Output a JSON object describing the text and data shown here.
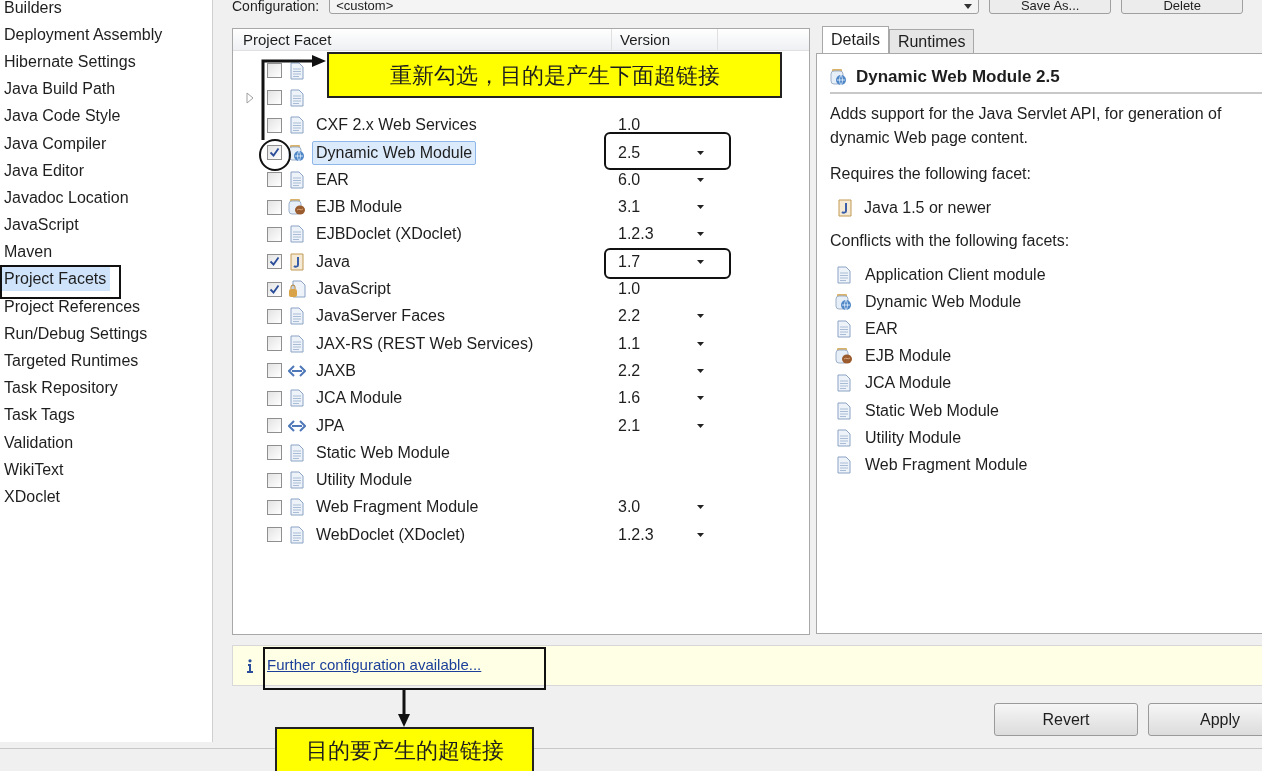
{
  "sidebar": {
    "items": [
      {
        "label": "Builders",
        "selected": false
      },
      {
        "label": "Deployment Assembly",
        "selected": false
      },
      {
        "label": "Hibernate Settings",
        "selected": false
      },
      {
        "label": "Java Build Path",
        "selected": false
      },
      {
        "label": "Java Code Style",
        "selected": false
      },
      {
        "label": "Java Compiler",
        "selected": false
      },
      {
        "label": "Java Editor",
        "selected": false
      },
      {
        "label": "Javadoc Location",
        "selected": false
      },
      {
        "label": "JavaScript",
        "selected": false
      },
      {
        "label": "Maven",
        "selected": false
      },
      {
        "label": "Project Facets",
        "selected": true
      },
      {
        "label": "Project References",
        "selected": false
      },
      {
        "label": "Run/Debug Settings",
        "selected": false
      },
      {
        "label": "Targeted Runtimes",
        "selected": false
      },
      {
        "label": "Task Repository",
        "selected": false
      },
      {
        "label": "Task Tags",
        "selected": false
      },
      {
        "label": "Validation",
        "selected": false
      },
      {
        "label": "WikiText",
        "selected": false
      },
      {
        "label": "XDoclet",
        "selected": false
      }
    ]
  },
  "configuration": {
    "label": "Configuration:",
    "value": "<custom>",
    "buttons": [
      "Save As...",
      "Delete"
    ]
  },
  "table": {
    "columns": [
      "Project Facet",
      "Version"
    ],
    "rows": [
      {
        "kind": "file",
        "checked": false,
        "selected": false,
        "expander": false,
        "dropdown": false
      },
      {
        "kind": "file",
        "checked": false,
        "selected": false,
        "expander": true,
        "dropdown": false
      },
      {
        "kind": "file",
        "label": "CXF 2.x Web Services",
        "version": "1.0",
        "checked": false,
        "selected": false,
        "expander": false,
        "dropdown": false
      },
      {
        "kind": "web",
        "label": "Dynamic Web Module",
        "version": "2.5",
        "checked": true,
        "selected": true,
        "expander": false,
        "dropdown": true
      },
      {
        "kind": "file",
        "label": "EAR",
        "version": "6.0",
        "checked": false,
        "selected": false,
        "expander": false,
        "dropdown": true
      },
      {
        "kind": "ejb",
        "label": "EJB Module",
        "version": "3.1",
        "checked": false,
        "selected": false,
        "expander": false,
        "dropdown": true
      },
      {
        "kind": "file",
        "label": "EJBDoclet (XDoclet)",
        "version": "1.2.3",
        "checked": false,
        "selected": false,
        "expander": false,
        "dropdown": true
      },
      {
        "kind": "java",
        "label": "Java",
        "version": "1.7",
        "checked": true,
        "selected": false,
        "expander": false,
        "dropdown": true
      },
      {
        "kind": "script",
        "label": "JavaScript",
        "version": "1.0",
        "checked": true,
        "selected": false,
        "expander": false,
        "dropdown": false
      },
      {
        "kind": "file",
        "label": "JavaServer Faces",
        "version": "2.2",
        "checked": false,
        "selected": false,
        "expander": false,
        "dropdown": true
      },
      {
        "kind": "file",
        "label": "JAX-RS (REST Web Services)",
        "version": "1.1",
        "checked": false,
        "selected": false,
        "expander": false,
        "dropdown": true
      },
      {
        "kind": "binding",
        "label": "JAXB",
        "version": "2.2",
        "checked": false,
        "selected": false,
        "expander": false,
        "dropdown": true
      },
      {
        "kind": "file",
        "label": "JCA Module",
        "version": "1.6",
        "checked": false,
        "selected": false,
        "expander": false,
        "dropdown": true
      },
      {
        "kind": "binding",
        "label": "JPA",
        "version": "2.1",
        "checked": false,
        "selected": false,
        "expander": false,
        "dropdown": true
      },
      {
        "kind": "file",
        "label": "Static Web Module",
        "checked": false,
        "selected": false,
        "expander": false,
        "dropdown": false
      },
      {
        "kind": "file",
        "label": "Utility Module",
        "checked": false,
        "selected": false,
        "expander": false,
        "dropdown": false
      },
      {
        "kind": "file",
        "label": "Web Fragment Module",
        "version": "3.0",
        "checked": false,
        "selected": false,
        "expander": false,
        "dropdown": true
      },
      {
        "kind": "file",
        "label": "WebDoclet (XDoclet)",
        "version": "1.2.3",
        "checked": false,
        "selected": false,
        "expander": false,
        "dropdown": true
      }
    ]
  },
  "details": {
    "tabs": [
      {
        "label": "Details",
        "selected": true
      },
      {
        "label": "Runtimes",
        "selected": false
      }
    ],
    "title": {
      "kind": "web",
      "text": "Dynamic Web Module 2.5"
    },
    "description": "Adds support for the Java Servlet API, for generation of dynamic Web page content.",
    "requires_heading": "Requires the following facet:",
    "requires": [
      {
        "kind": "java",
        "label": "Java 1.5 or newer"
      }
    ],
    "conflicts_heading": "Conflicts with the following facets:",
    "conflicts": [
      {
        "kind": "file",
        "label": "Application Client module"
      },
      {
        "kind": "web",
        "label": "Dynamic Web Module"
      },
      {
        "kind": "file",
        "label": "EAR"
      },
      {
        "kind": "ejb",
        "label": "EJB Module"
      },
      {
        "kind": "file",
        "label": "JCA Module"
      },
      {
        "kind": "file",
        "label": "Static Web Module"
      },
      {
        "kind": "file",
        "label": "Utility Module"
      },
      {
        "kind": "file",
        "label": "Web Fragment Module"
      }
    ]
  },
  "info_bar": {
    "link": "Further configuration available..."
  },
  "buttons": [
    "Revert",
    "Apply"
  ],
  "annotations": {
    "top_callout": "重新勾选，目的是产生下面超链接",
    "bottom_callout": "目的要产生的超链接"
  }
}
